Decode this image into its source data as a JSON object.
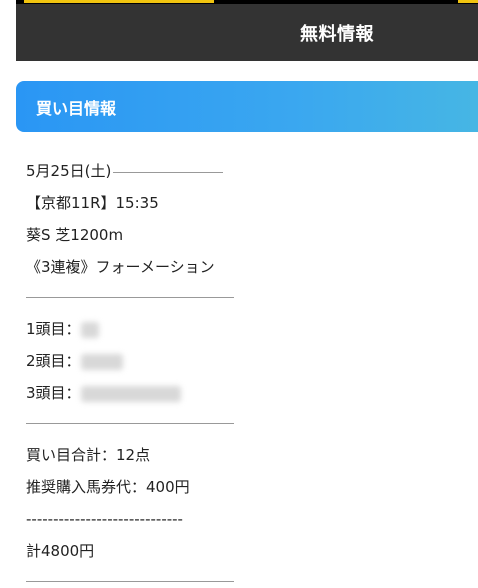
{
  "header": {
    "title": "無料情報"
  },
  "section": {
    "title": "買い目情報"
  },
  "race": {
    "date": "5月25日(土)",
    "venue": "【京都11R】15:35",
    "race_name": "葵S 芝1200m",
    "bet_type": "《3連複》フォーメーション"
  },
  "picks": {
    "first_label": "1頭目：",
    "second_label": "2頭目：",
    "third_label": "3頭目："
  },
  "summary": {
    "total_points": "買い目合計：12点",
    "recommended": "推奨購入馬券代：400円",
    "dashes": "-----------------------------",
    "total_cost": "計4800円"
  },
  "colors": {
    "header_bg": "#333333",
    "accent_start": "#2a96f4",
    "accent_end": "#46b6e4"
  }
}
